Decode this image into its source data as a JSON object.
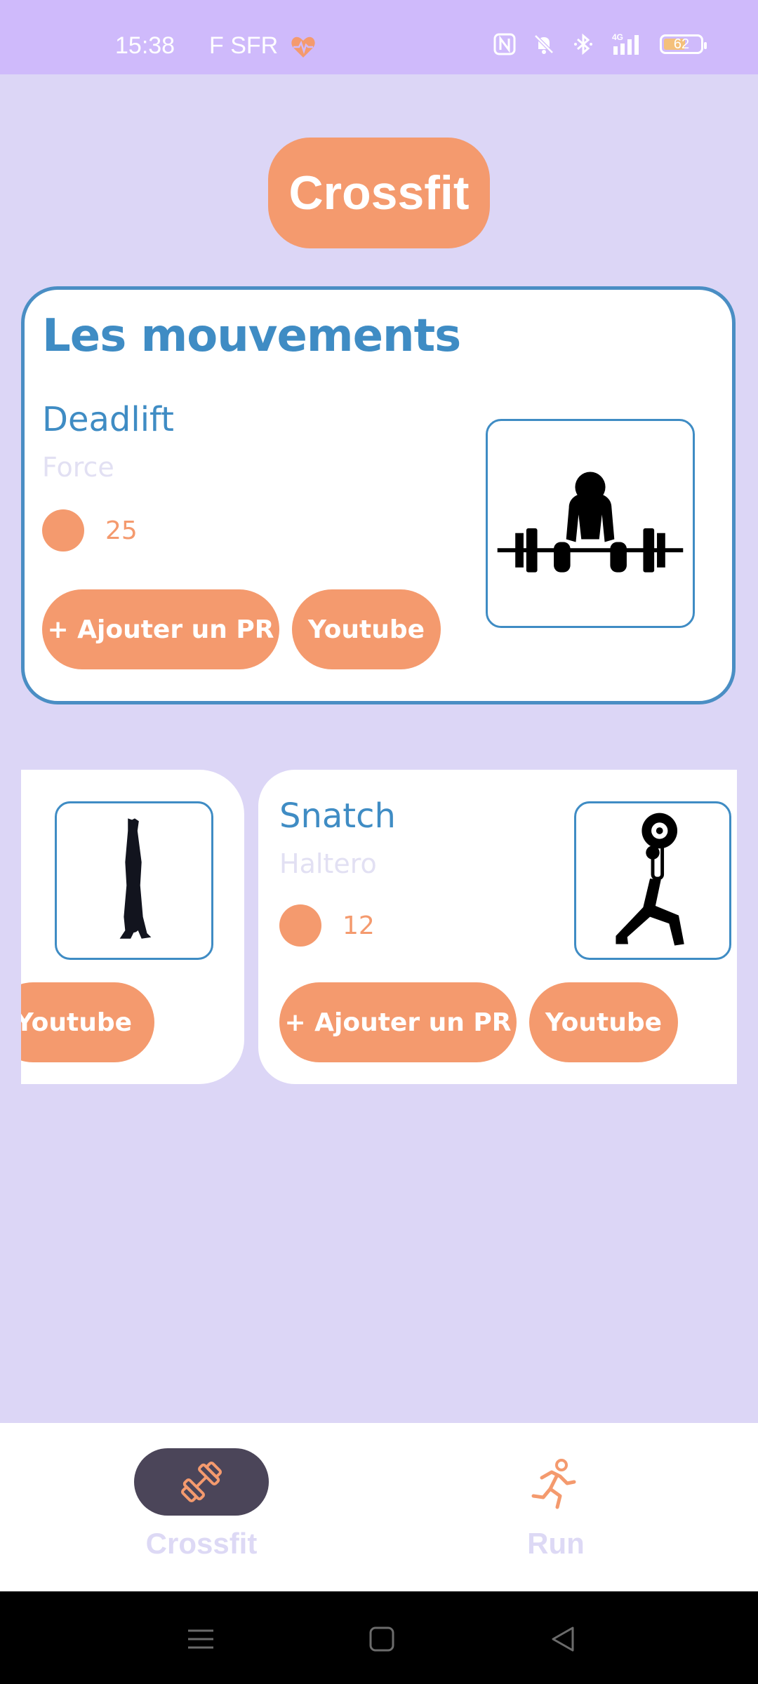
{
  "status_bar": {
    "time": "15:38",
    "carrier": "F SFR",
    "battery": "62",
    "icons": [
      "heart-pulse-icon",
      "nfc-icon",
      "mute-bell-icon",
      "bluetooth-icon",
      "signal-4g-icon",
      "battery-icon"
    ]
  },
  "header": {
    "title": "Crossfit"
  },
  "main_card": {
    "section_title": "Les mouvements",
    "name": "Deadlift",
    "category": "Force",
    "count": "25",
    "add_pr_label": "+ Ajouter un PR",
    "youtube_label": "Youtube",
    "image_icon": "deadlift-icon"
  },
  "left_card": {
    "youtube_label": "Youtube",
    "image_icon": "handstand-icon"
  },
  "snatch_card": {
    "name": "Snatch",
    "category": "Haltero",
    "count": "12",
    "add_pr_label": "+ Ajouter un PR",
    "youtube_label": "Youtube",
    "image_icon": "snatch-icon"
  },
  "bottom_nav": {
    "items": [
      {
        "label": "Crossfit",
        "icon": "dumbbell-icon",
        "active": true
      },
      {
        "label": "Run",
        "icon": "running-icon",
        "active": false
      }
    ]
  },
  "system_nav": {
    "icons": [
      "menu-icon",
      "home-icon",
      "back-icon"
    ]
  },
  "colors": {
    "accent": "#f49a6e",
    "primary_blue": "#3f8cc4",
    "background": "#dcd6f6",
    "status_bar": "#cfbafb"
  }
}
